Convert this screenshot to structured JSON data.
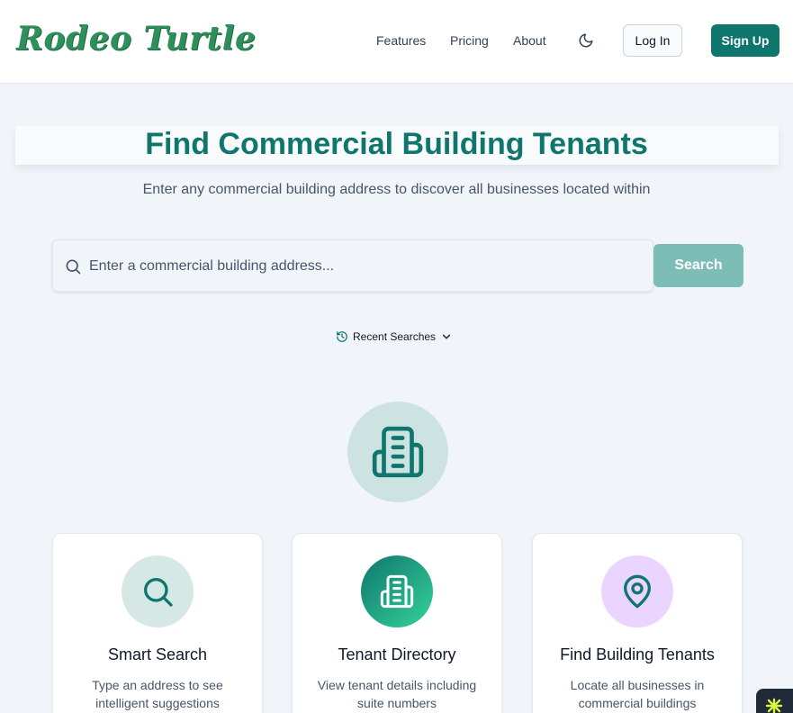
{
  "header": {
    "logo": "Rodeo Turtle",
    "nav": {
      "features": "Features",
      "pricing": "Pricing",
      "about": "About"
    },
    "theme_toggle_icon": "moon-icon",
    "login_label": "Log In",
    "signup_label": "Sign Up"
  },
  "hero": {
    "title": "Find Commercial Building Tenants",
    "subtitle": "Enter any commercial building address to discover all businesses located within",
    "icon": "building-icon"
  },
  "search": {
    "placeholder": "Enter a commercial building address...",
    "value": "",
    "button_label": "Search",
    "icon": "search-icon"
  },
  "recent_searches": {
    "label": "Recent Searches",
    "icon": "history-icon",
    "toggle_icon": "chevron-down-icon"
  },
  "features": [
    {
      "title": "Smart Search",
      "description": "Type an address to see intelligent suggestions",
      "icon": "search-icon"
    },
    {
      "title": "Tenant Directory",
      "description": "View tenant details including suite numbers",
      "icon": "building-icon"
    },
    {
      "title": "Find Building Tenants",
      "description": "Locate all businesses in commercial buildings",
      "icon": "map-pin-icon"
    }
  ],
  "colors": {
    "brand": "#0f766e",
    "logo": "#2f8f5b",
    "search_button": "#7dbdb5",
    "hero_circle": "#cde3e1",
    "page_background": "#f1f5f9"
  }
}
